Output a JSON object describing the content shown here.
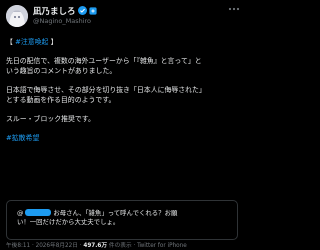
{
  "author": {
    "display_name": "凪乃ましろ",
    "handle": "@Nagino_Mashiro"
  },
  "post": {
    "line1": "【 #注意喚起 】",
    "line2": "先日の配信で、複数の海外ユーザーから「『雑魚』と言って」と",
    "line3": "いう趣旨のコメントがありました。",
    "line4": "日本語で侮辱させ、その部分を切り抜き「日本人に侮辱された」",
    "line5": "とする動画を作る目的のようです。",
    "line6": "スルー・ブロック推奨です。",
    "line7": "#拡散希望",
    "hashtag_alert": "#注意喚起",
    "hashtag_spread": "#拡散希望"
  },
  "quoted": {
    "at": "@",
    "line1": "お母さん、「雑魚」って呼んでくれる？お願",
    "line2": "い！一回だけだから大丈夫でしょ。"
  },
  "meta": {
    "time": "午後8:11 · 2026年8月22日 · ",
    "views_count": "497.6万",
    "views_label": " 件の表示",
    "client": " · Twitter for iPhone"
  },
  "colors": {
    "link": "#1d9bf0",
    "background": "#000000",
    "muted": "#71767b"
  }
}
